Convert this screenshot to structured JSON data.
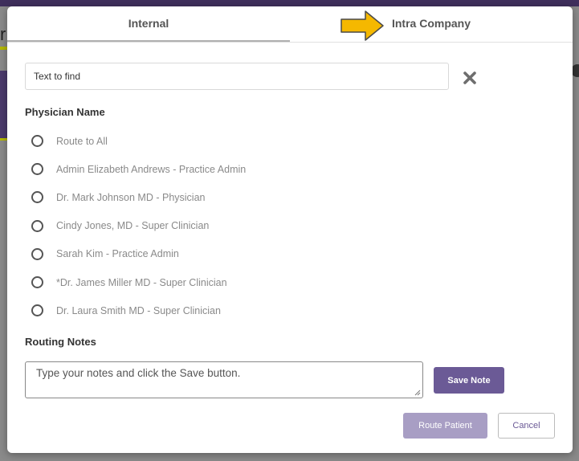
{
  "background": {
    "partial_letter": "r"
  },
  "modal": {
    "tabs": [
      {
        "label": "Internal"
      },
      {
        "label": "Intra Company"
      }
    ],
    "search": {
      "placeholder": "Text to find",
      "value": ""
    },
    "physician_label": "Physician Name",
    "physicians": [
      {
        "label": "Route to All"
      },
      {
        "label": "Admin Elizabeth Andrews - Practice Admin"
      },
      {
        "label": "Dr. Mark Johnson MD - Physician"
      },
      {
        "label": "Cindy Jones, MD - Super Clinician"
      },
      {
        "label": "Sarah Kim - Practice Admin"
      },
      {
        "label": "*Dr. James Miller MD - Super Clinician"
      },
      {
        "label": "Dr. Laura Smith MD - Super Clinician"
      }
    ],
    "notes_label": "Routing Notes",
    "notes": {
      "placeholder": "Type your notes and click the Save button.",
      "value": ""
    },
    "buttons": {
      "save_note": "Save Note",
      "route_patient": "Route Patient",
      "cancel": "Cancel"
    },
    "icons": {
      "clear": "close-x-icon",
      "tab_pointer": "arrow-right-icon"
    },
    "colors": {
      "accent": "#6b5a96",
      "accent_disabled": "#a89ec4",
      "arrow_fill": "#f5b800"
    }
  }
}
